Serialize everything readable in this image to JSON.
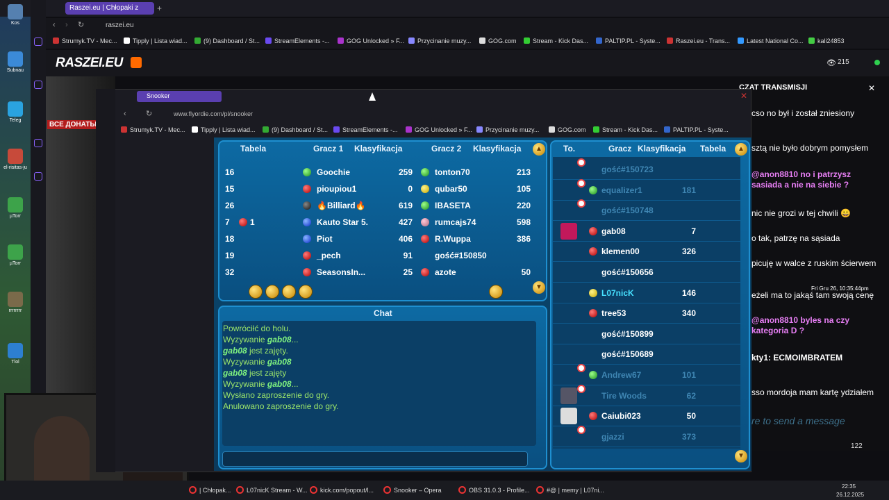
{
  "outer_browser": {
    "tab_title": "Raszei.eu | Chłopaki z",
    "url": "raszei.eu",
    "bookmarks": [
      "Strumyk.TV - Mec...",
      "Tipply | Lista wiad...",
      "(9) Dashboard / St...",
      "StreamElements -...",
      "GOG Unlocked » F...",
      "Przycinanie muzy...",
      "GOG.com",
      "Stream - Kick Das...",
      "PALTIP.PL - Syste...",
      "Raszei.eu - Trans...",
      "Latest National Co...",
      "kali24853"
    ]
  },
  "site": {
    "logo": "RASZEI.EU",
    "viewer_count": "215",
    "banner": "ВСЕ ДОНАТЫ"
  },
  "desktop_icons": [
    "Kos",
    "Subnau",
    "Teleg",
    "el-risitas-ju",
    "µTorr",
    "µTorr",
    "rrrrrrrr",
    "Tlol"
  ],
  "stream_chat": {
    "title": "CZAT TRANSMISJI",
    "messages": [
      {
        "text": "cso no był i został zniesiony",
        "style": "normal"
      },
      {
        "text": "sztą nie było dobrym pomysłem",
        "style": "normal"
      },
      {
        "text": "@anon8810 no i patrzysz sasiada a nie na siebie ?",
        "style": "pink"
      },
      {
        "text": "nic nie grozi w tej chwili 😀",
        "style": "normal"
      },
      {
        "text": "o tak, patrzę na sąsiada",
        "style": "normal"
      },
      {
        "text": "picuję w walce z ruskim ścierwem",
        "style": "normal"
      },
      {
        "text": "Fri Gru 26, 10:35:44pm",
        "style": "small"
      },
      {
        "text": "eżeli ma to jakąś tam swoją cenę",
        "style": "normal"
      },
      {
        "text": "@anon8810 byles na czy kategoria D ?",
        "style": "pink"
      },
      {
        "text": "kty1: ECMOIMBRATEM",
        "style": "bold"
      },
      {
        "text": "sso mordoja mam kartę ydziałem",
        "style": "normal"
      }
    ],
    "input_placeholder": "re to send a message",
    "counter": "122"
  },
  "inner_browser": {
    "tab_title": "Snooker",
    "url": "www.flyordie.com/pl/snooker",
    "bookmarks": [
      "Strumyk.TV - Mec...",
      "Tipply | Lista wiad...",
      "(9) Dashboard / St...",
      "StreamElements -...",
      "GOG Unlocked » F...",
      "Przycinanie muzy...",
      "GOG.com",
      "Stream - Kick Das...",
      "PALTIP.PL - Syste..."
    ]
  },
  "game": {
    "table_headers": {
      "table": "Tabela",
      "player1": "Gracz 1",
      "rank1": "Klasyfikacja",
      "player2": "Gracz 2",
      "rank2": "Klasyfikacja"
    },
    "tables": [
      {
        "table": "16",
        "p1": "Goochie",
        "c1": "g",
        "r1": "259",
        "p2": "tonton70",
        "c2": "g",
        "r2": "213"
      },
      {
        "table": "15",
        "p1": "pioupiou1",
        "c1": "r",
        "r1": "0",
        "p2": "qubar50",
        "c2": "y",
        "r2": "105"
      },
      {
        "table": "26",
        "p1": "🔥Billiard🔥",
        "c1": "k",
        "r1": "619",
        "p2": "IBASETA",
        "c2": "g",
        "r2": "220"
      },
      {
        "table": "7",
        "extra": "1",
        "p1": "Kauto Star 5.",
        "c1": "b",
        "r1": "427",
        "p2": "rumcajs74",
        "c2": "pk",
        "r2": "598"
      },
      {
        "table": "18",
        "p1": "Piot",
        "c1": "b",
        "r1": "406",
        "p2": "R.Wuppa",
        "c2": "r",
        "r2": "386"
      },
      {
        "table": "19",
        "p1": "_pech",
        "c1": "r",
        "r1": "91",
        "p2": "gość#150850",
        "c2": "",
        "r2": ""
      },
      {
        "table": "32",
        "p1": "SeasonsIn...",
        "c1": "r",
        "r1": "25",
        "p2": "azote",
        "c2": "r",
        "r2": "50"
      }
    ],
    "chat_title": "Chat",
    "chat_lines": [
      {
        "pre": "Powróciłć do holu.",
        "name": "",
        "post": ""
      },
      {
        "pre": "Wyzywanie ",
        "name": "gab08",
        "post": "..."
      },
      {
        "pre": "",
        "name": "gab08",
        "post": " jest zajęty."
      },
      {
        "pre": "Wyzywanie ",
        "name": "gab08",
        "post": ""
      },
      {
        "pre": "",
        "name": "gab08",
        "post": " jest zajęty"
      },
      {
        "pre": "Wyzywanie ",
        "name": "gab08",
        "post": "..."
      },
      {
        "pre": "Wysłano zaproszenie do gry.",
        "name": "",
        "post": ""
      },
      {
        "pre": "Anulowano zaproszenie do gry.",
        "name": "",
        "post": ""
      }
    ],
    "list_headers": {
      "to": "To.",
      "player": "Gracz",
      "rank": "Klasyfikacja",
      "table": "Tabela"
    },
    "players": [
      {
        "name": "gość#150723",
        "rank": "",
        "dim": true,
        "clock": true,
        "ball": ""
      },
      {
        "name": "equalizer1",
        "rank": "181",
        "dim": true,
        "clock": true,
        "ball": "g"
      },
      {
        "name": "gość#150748",
        "rank": "",
        "dim": true,
        "clock": true,
        "ball": ""
      },
      {
        "name": "gab08",
        "rank": "7",
        "dim": false,
        "clock": false,
        "ball": "r",
        "avatar": "#c2185b"
      },
      {
        "name": "klemen00",
        "rank": "326",
        "dim": false,
        "clock": false,
        "ball": "r"
      },
      {
        "name": "gość#150656",
        "rank": "",
        "dim": false,
        "clock": false,
        "ball": ""
      },
      {
        "name": "L07nicK",
        "rank": "146",
        "dim": false,
        "clock": false,
        "ball": "y",
        "cyan": true
      },
      {
        "name": "tree53",
        "rank": "340",
        "dim": false,
        "clock": false,
        "ball": "r"
      },
      {
        "name": "gość#150899",
        "rank": "",
        "dim": false,
        "clock": false,
        "ball": ""
      },
      {
        "name": "gość#150689",
        "rank": "",
        "dim": false,
        "clock": false,
        "ball": ""
      },
      {
        "name": "Andrew67",
        "rank": "101",
        "dim": true,
        "clock": true,
        "ball": "g"
      },
      {
        "name": "Tire Woods",
        "rank": "62",
        "dim": true,
        "clock": true,
        "ball": "",
        "avatar": "#556"
      },
      {
        "name": "Caiubi023",
        "rank": "50",
        "dim": false,
        "clock": false,
        "ball": "r",
        "avatar": "#ddd"
      },
      {
        "name": "gjazzi",
        "rank": "373",
        "dim": true,
        "clock": true,
        "ball": ""
      }
    ]
  },
  "taskbar": {
    "items": [
      "| Chłopak...",
      "L07nicK Stream - W...",
      "kick.com/popout/l...",
      "Snooker – Opera",
      "OBS 31.0.3 - Profile...",
      "#@ | memy | L07ni..."
    ],
    "time": "22:35",
    "date": "26.12.2025"
  }
}
